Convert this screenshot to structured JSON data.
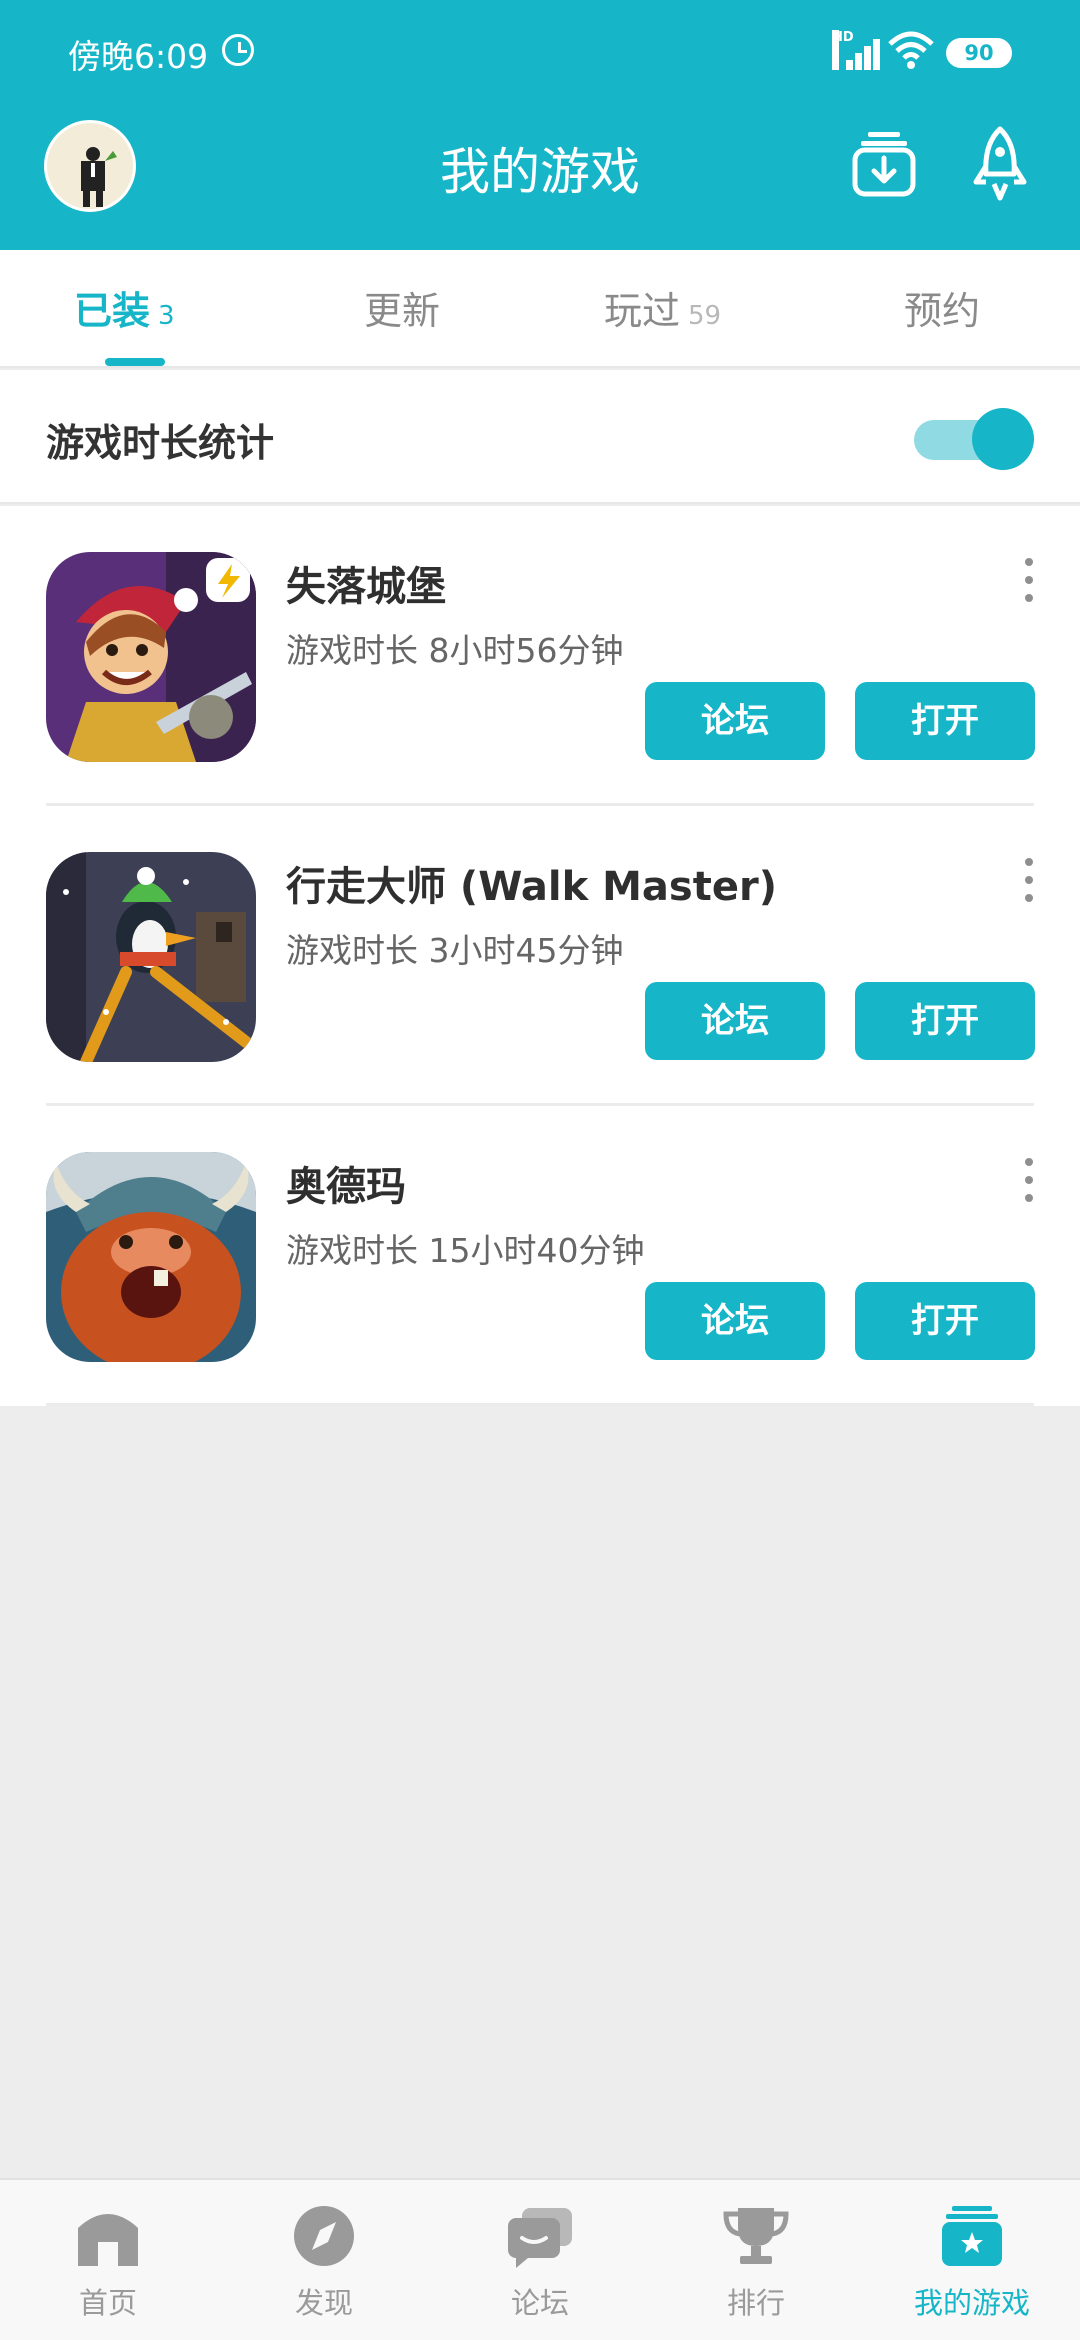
{
  "status_bar": {
    "time": "傍晚6:09",
    "network": "HD",
    "battery": "90"
  },
  "header": {
    "title": "我的游戏"
  },
  "tabs": [
    {
      "label": "已装",
      "count": "3"
    },
    {
      "label": "更新",
      "count": ""
    },
    {
      "label": "玩过",
      "count": "59"
    },
    {
      "label": "预约",
      "count": ""
    }
  ],
  "stats": {
    "label": "游戏时长统计",
    "enabled": true
  },
  "games": [
    {
      "name": "失落城堡",
      "playtime": "游戏时长 8小时56分钟",
      "forum_label": "论坛",
      "open_label": "打开"
    },
    {
      "name": "行走大师 (Walk Master)",
      "playtime": "游戏时长 3小时45分钟",
      "forum_label": "论坛",
      "open_label": "打开"
    },
    {
      "name": "奥德玛",
      "playtime": "游戏时长 15小时40分钟",
      "forum_label": "论坛",
      "open_label": "打开"
    }
  ],
  "bottom_nav": [
    {
      "label": "首页",
      "icon": "home-icon"
    },
    {
      "label": "发现",
      "icon": "compass-icon"
    },
    {
      "label": "论坛",
      "icon": "forum-icon"
    },
    {
      "label": "排行",
      "icon": "trophy-icon"
    },
    {
      "label": "我的游戏",
      "icon": "my-games-icon"
    }
  ],
  "colors": {
    "accent": "#16b6c8",
    "background": "#ededed"
  }
}
